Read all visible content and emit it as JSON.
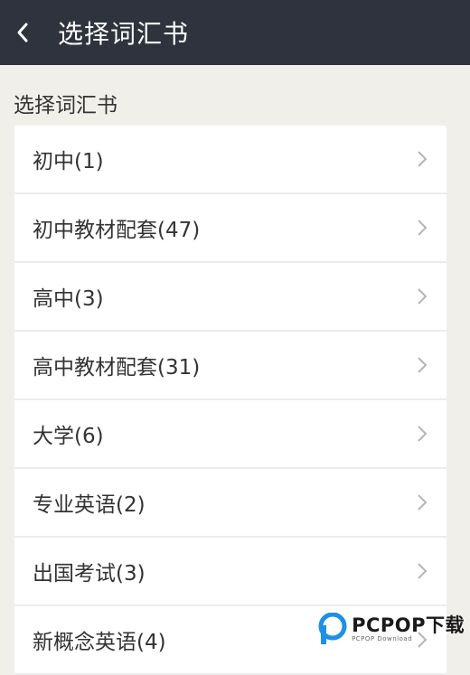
{
  "header": {
    "title": "选择词汇书"
  },
  "section": {
    "label": "选择词汇书"
  },
  "items": [
    {
      "label": "初中(1)"
    },
    {
      "label": "初中教材配套(47)"
    },
    {
      "label": "高中(3)"
    },
    {
      "label": "高中教材配套(31)"
    },
    {
      "label": "大学(6)"
    },
    {
      "label": "专业英语(2)"
    },
    {
      "label": "出国考试(3)"
    },
    {
      "label": "新概念英语(4)"
    }
  ],
  "watermark": {
    "main": "PCPOP下载",
    "sub": "PCPOP Download"
  },
  "colors": {
    "header_bg": "#2f333d",
    "page_bg": "#f1efea",
    "logo_blue": "#1e90e8"
  }
}
